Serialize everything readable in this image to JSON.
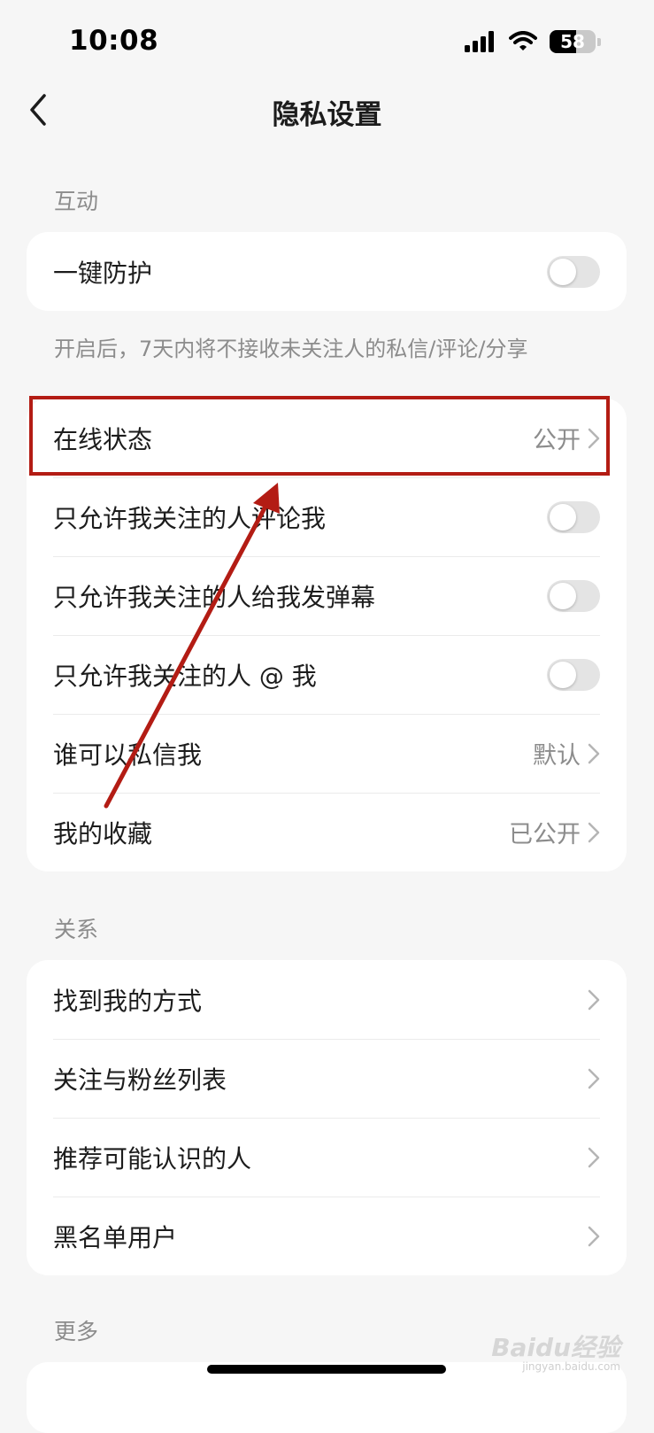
{
  "status_bar": {
    "time": "10:08",
    "battery": "58",
    "battery_level": 0.58
  },
  "header": {
    "title": "隐私设置"
  },
  "sections": {
    "interaction": {
      "label": "互动",
      "protect_label": "一键防护",
      "protect_on": false,
      "hint": "开启后，7天内将不接收未关注人的私信/评论/分享"
    },
    "privacy": {
      "online_status": {
        "label": "在线状态",
        "value": "公开"
      },
      "comment_only_follow": {
        "label": "只允许我关注的人评论我",
        "on": false
      },
      "danmaku_only_follow": {
        "label": "只允许我关注的人给我发弹幕",
        "on": false
      },
      "mention_only_follow": {
        "label": "只允许我关注的人 @ 我",
        "on": false
      },
      "who_can_dm": {
        "label": "谁可以私信我",
        "value": "默认"
      },
      "favorites": {
        "label": "我的收藏",
        "value": "已公开"
      }
    },
    "relations": {
      "label": "关系",
      "items": [
        "找到我的方式",
        "关注与粉丝列表",
        "推荐可能认识的人",
        "黑名单用户"
      ]
    },
    "more": {
      "label": "更多"
    }
  },
  "annotation": {
    "color": "#b31c14"
  },
  "watermark": {
    "text": "Baidu经验",
    "sub": "jingyan.baidu.com"
  }
}
